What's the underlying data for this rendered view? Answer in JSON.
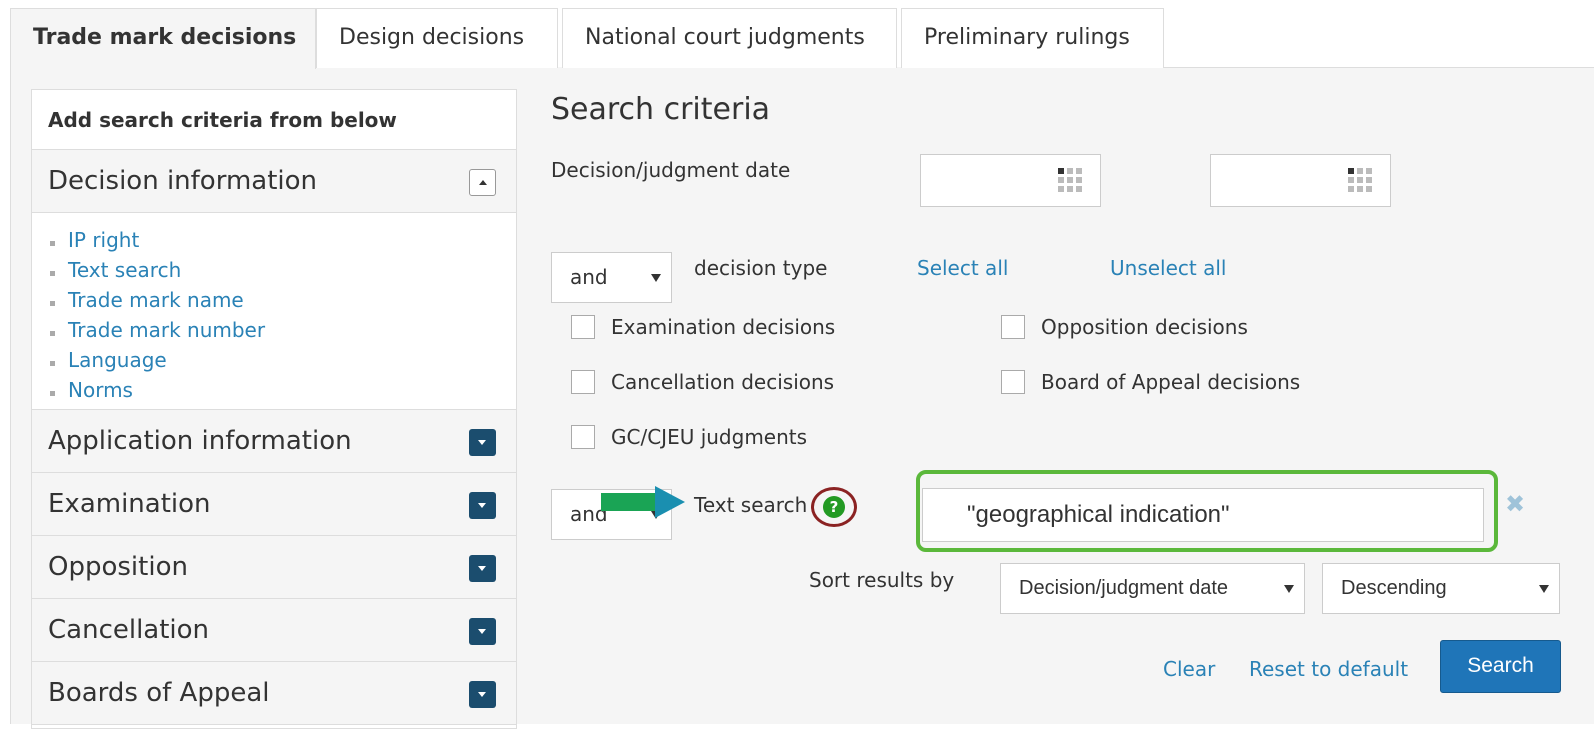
{
  "tabs": [
    {
      "label": "Trade mark decisions",
      "active": true
    },
    {
      "label": "Design decisions"
    },
    {
      "label": "National court judgments"
    },
    {
      "label": "Preliminary rulings"
    }
  ],
  "sidebar": {
    "heading": "Add search criteria from below",
    "sections": [
      {
        "label": "Decision information",
        "expanded": true,
        "items": [
          "IP right",
          "Text search",
          "Trade mark name",
          "Trade mark number",
          "Language",
          "Norms"
        ]
      },
      {
        "label": "Application information"
      },
      {
        "label": "Examination"
      },
      {
        "label": "Opposition"
      },
      {
        "label": "Cancellation"
      },
      {
        "label": "Boards of Appeal"
      }
    ]
  },
  "main": {
    "title": "Search criteria",
    "date_label": "Decision/judgment date",
    "date_from": "",
    "date_to": "",
    "decision_type": {
      "operator": "and",
      "label": "decision type",
      "select_all": "Select all",
      "unselect_all": "Unselect all",
      "options": [
        "Examination decisions",
        "Opposition decisions",
        "Cancellation decisions",
        "Board of Appeal decisions",
        "GC/CJEU judgments"
      ]
    },
    "text_search": {
      "operator": "and",
      "label": "Text search",
      "help_glyph": "?",
      "value": "\"geographical indication\"",
      "clear_glyph": "✖"
    },
    "sort": {
      "label": "Sort results by",
      "field": "Decision/judgment date",
      "order": "Descending"
    },
    "actions": {
      "clear": "Clear",
      "reset": "Reset to default",
      "search": "Search"
    }
  },
  "colors": {
    "link": "#2a82b6",
    "search_button": "#1f75b8",
    "highlight_frame": "#5bb83b",
    "help_ring": "#8b2323",
    "arrow": "#1aa455"
  }
}
